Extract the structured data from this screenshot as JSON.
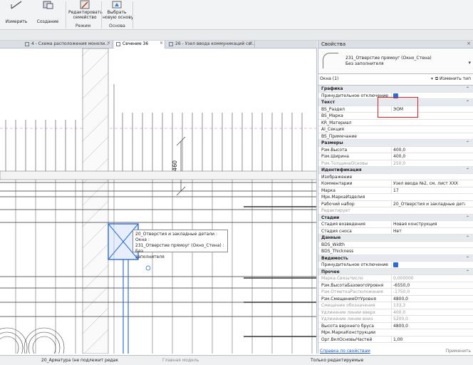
{
  "ribbon": {
    "buttons": [
      {
        "label": "Измерить"
      },
      {
        "label": "Создание"
      },
      {
        "label": "Редактировать\nсемейство"
      },
      {
        "label": "Выбрать\nновую основу"
      }
    ],
    "groups": [
      "Режим",
      "Основа"
    ]
  },
  "tabs": [
    {
      "label": "4 - Схема расположения моноли...",
      "active": false
    },
    {
      "label": "Сечение 36",
      "active": true
    },
    {
      "label": "26 - Узел ввода коммуникаций св...",
      "active": false
    }
  ],
  "canvas": {
    "dimension_value": "460",
    "tooltip_lines": [
      "20_Отверстия и закладные детали : Окна :",
      "231_Отверстие прямоуг (Окно_Стена) : Без",
      "заполнителя"
    ]
  },
  "properties": {
    "title": "Свойства",
    "type_name_line1": "231_Отверстие прямоуг (Окно_Стена)",
    "type_name_line2": "Без заполнителя",
    "filter": "Окна (1)",
    "edit_type": "Изменить тип",
    "help_link": "Справка по свойствам",
    "apply": "Применить",
    "rows": [
      {
        "kind": "group",
        "k": "Графика"
      },
      {
        "kind": "prop",
        "k": "Принудительное отключение ...",
        "check": true
      },
      {
        "kind": "group",
        "k": "Текст"
      },
      {
        "kind": "prop",
        "k": "BS_Раздел",
        "v": "ЭОМ"
      },
      {
        "kind": "prop",
        "k": "BS_Марка",
        "v": ""
      },
      {
        "kind": "prop",
        "k": "KR_Материал",
        "v": ""
      },
      {
        "kind": "prop",
        "k": "AI_Секция",
        "v": ""
      },
      {
        "kind": "prop",
        "k": "BS_Примечание",
        "v": ""
      },
      {
        "kind": "group",
        "k": "Размеры"
      },
      {
        "kind": "prop",
        "k": "Рзм.Высота",
        "v": "400,0"
      },
      {
        "kind": "prop",
        "k": "Рзм.Ширина",
        "v": "400,0"
      },
      {
        "kind": "dim",
        "k": "Рзм.ТолщинаОсновы",
        "v": "250,0"
      },
      {
        "kind": "group",
        "k": "Идентификация"
      },
      {
        "kind": "prop",
        "k": "Изображение",
        "v": ""
      },
      {
        "kind": "prop",
        "k": "Комментарии",
        "v": "Узел ввода №2, см. лист ХХХ"
      },
      {
        "kind": "prop",
        "k": "Марка",
        "v": "17"
      },
      {
        "kind": "prop",
        "k": "Мрк.МаркаИзделия",
        "v": ""
      },
      {
        "kind": "prop",
        "k": "Рабочий набор",
        "v": "20_Отверстия и закладные детали"
      },
      {
        "kind": "dim",
        "k": "Редактирует",
        "v": ""
      },
      {
        "kind": "group",
        "k": "Стадии"
      },
      {
        "kind": "prop",
        "k": "Стадия возведения",
        "v": "Новая конструкция"
      },
      {
        "kind": "prop",
        "k": "Стадия сноса",
        "v": "Нет"
      },
      {
        "kind": "group",
        "k": "Данные"
      },
      {
        "kind": "prop",
        "k": "BDS_Width",
        "v": ""
      },
      {
        "kind": "prop",
        "k": "BDS_Thickness",
        "v": ""
      },
      {
        "kind": "group",
        "k": "Видимость"
      },
      {
        "kind": "prop",
        "k": "Принудительное отключение ...",
        "check": true
      },
      {
        "kind": "group",
        "k": "Прочее"
      },
      {
        "kind": "dim",
        "k": "Марка.СвязьЧисло",
        "v": "0,000000"
      },
      {
        "kind": "prop",
        "k": "Рзм.ВысотаБазовогоУровня",
        "v": "-6550,0"
      },
      {
        "kind": "dim",
        "k": "Рзм.ОтметкаРасположения",
        "v": "-1750,0"
      },
      {
        "kind": "prop",
        "k": "Рзм.СмещениеОтУровня",
        "v": "4800,0"
      },
      {
        "kind": "dim",
        "k": "Смещение обозначения",
        "v": "133,3"
      },
      {
        "kind": "dim",
        "k": "Удлинение линии вверх",
        "v": "400,0"
      },
      {
        "kind": "dim",
        "k": "Удлинение линии вниз",
        "v": "5200,0"
      },
      {
        "kind": "prop",
        "k": "Высота верхнего бруса",
        "v": "4800,0"
      },
      {
        "kind": "prop",
        "k": "Мрк.МаркаКонструкции",
        "v": ""
      },
      {
        "kind": "prop",
        "k": "Орг.ВклОсновыЧастей",
        "v": "1,00"
      }
    ]
  },
  "status": {
    "workset": "20_Арматура (не подлежит редак",
    "model": "Главная модель",
    "editable_only": "Только редактируемые"
  }
}
